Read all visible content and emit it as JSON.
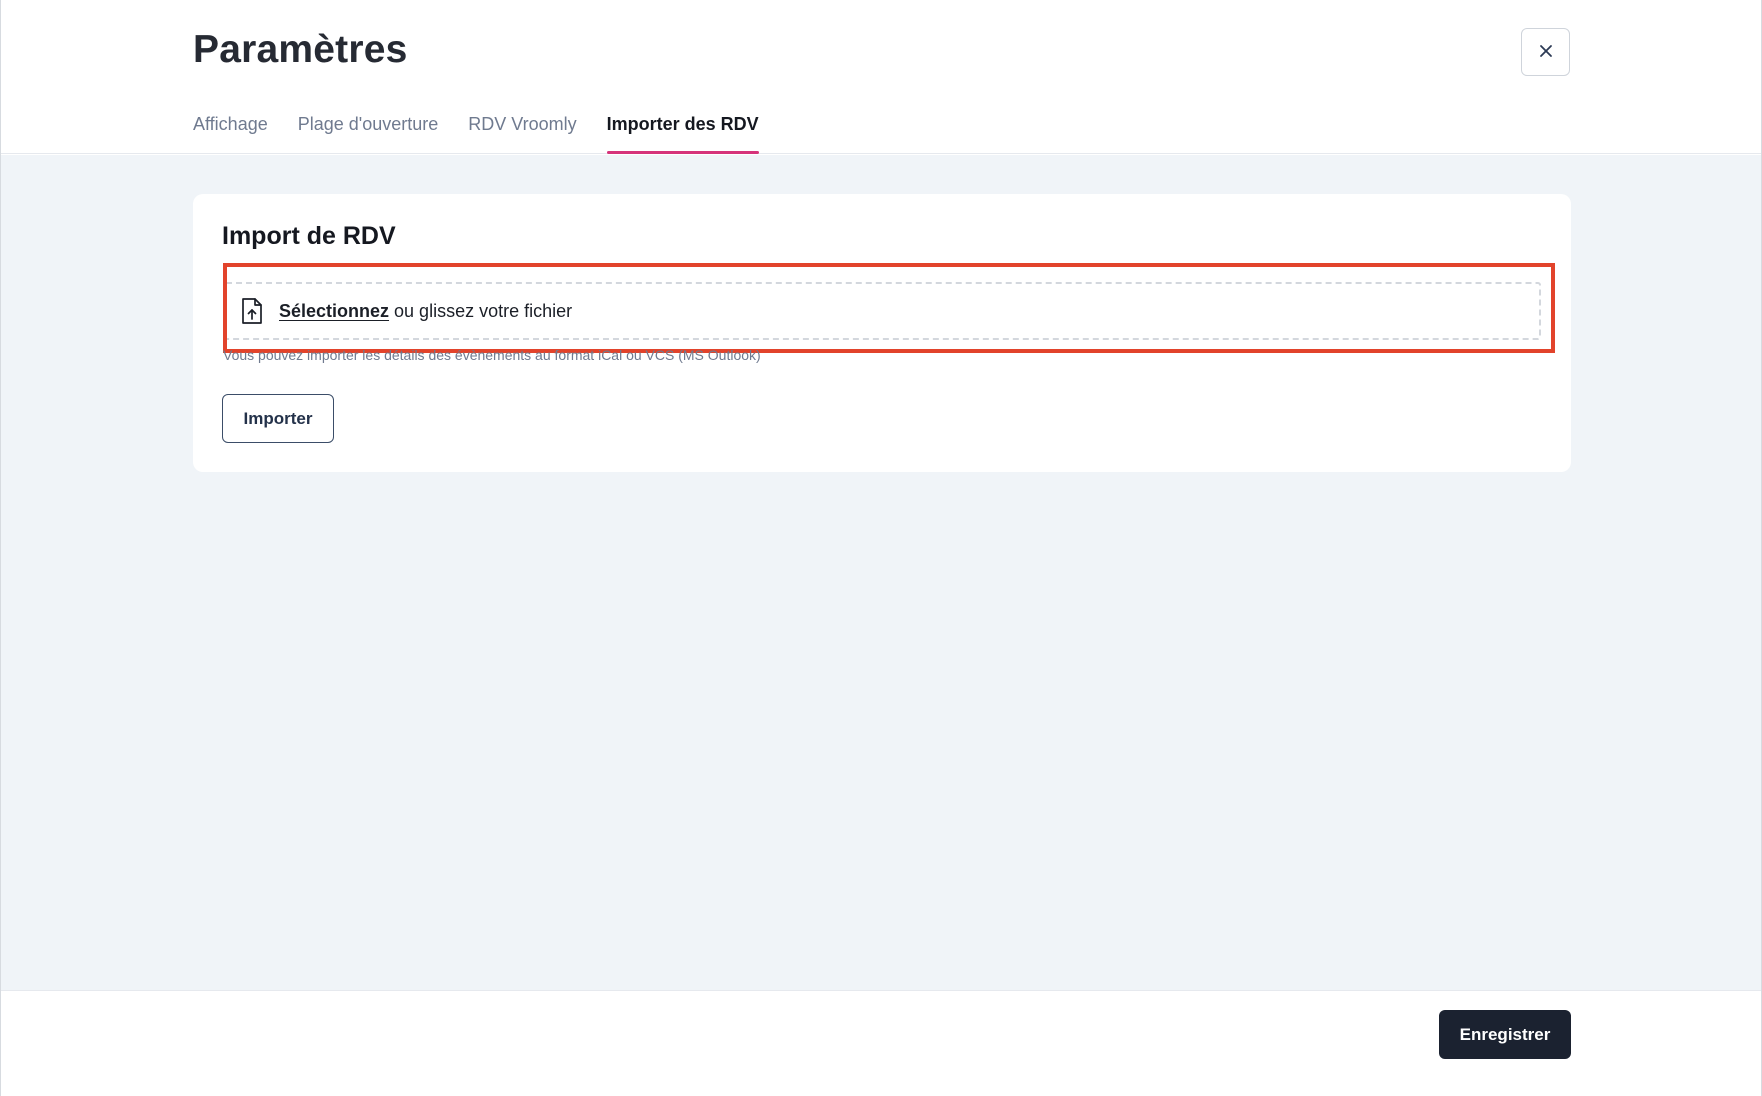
{
  "header": {
    "title": "Paramètres",
    "close_icon": "close-icon",
    "tabs": [
      {
        "label": "Affichage",
        "active": false
      },
      {
        "label": "Plage d'ouverture",
        "active": false
      },
      {
        "label": "RDV Vroomly",
        "active": false
      },
      {
        "label": "Importer des RDV",
        "active": true
      }
    ]
  },
  "card": {
    "title": "Import de RDV",
    "dropzone": {
      "icon": "file-upload-icon",
      "select_label": "Sélectionnez",
      "rest_label": " ou glissez votre fichier"
    },
    "help_text": "Vous pouvez importer les détails des évènements au format iCal ou VCS (MS Outlook)",
    "import_label": "Importer"
  },
  "footer": {
    "save_label": "Enregistrer"
  },
  "colors": {
    "active_tab_underline": "#d6337a",
    "highlight_border": "#e2432b",
    "primary_button": "#1b2230",
    "background": "#f0f4f8"
  }
}
